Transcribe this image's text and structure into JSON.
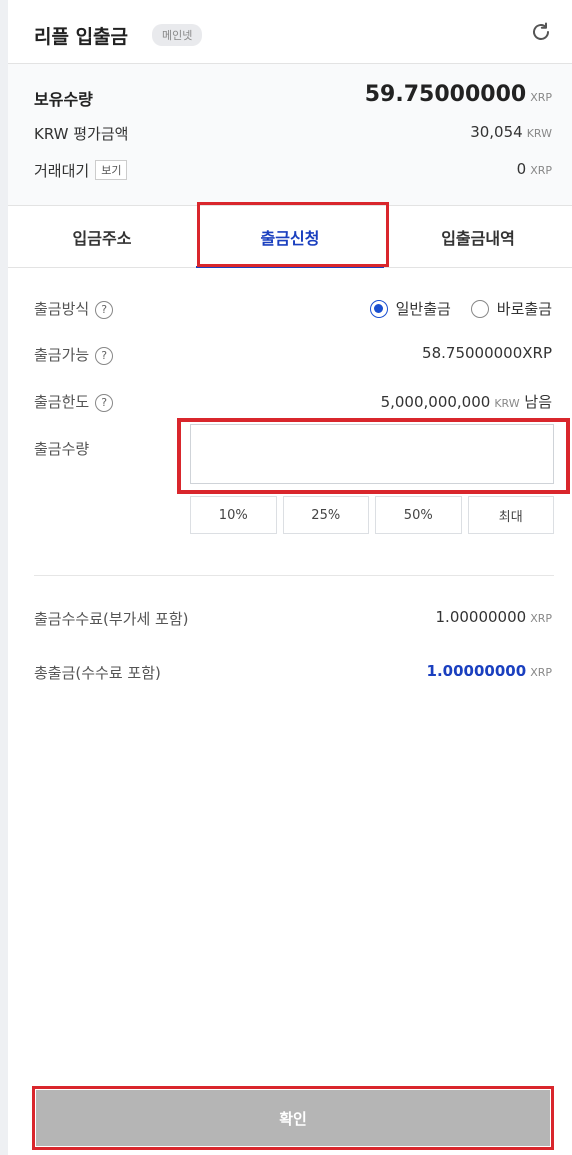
{
  "header": {
    "title": "리플 입출금",
    "network_badge": "메인넷",
    "refresh_icon": "refresh-icon"
  },
  "holdings": {
    "balance_label": "보유수량",
    "balance_value": "59.75000000",
    "balance_unit": "XRP",
    "krw_label": "KRW 평가금액",
    "krw_value": "30,054",
    "krw_unit": "KRW",
    "pending_label": "거래대기",
    "view_button": "보기",
    "pending_value": "0",
    "pending_unit": "XRP"
  },
  "tabs": [
    {
      "label": "입금주소",
      "active": false
    },
    {
      "label": "출금신청",
      "active": true
    },
    {
      "label": "입출금내역",
      "active": false
    }
  ],
  "form": {
    "method_label": "출금방식",
    "method_options": [
      {
        "label": "일반출금",
        "checked": true
      },
      {
        "label": "바로출금",
        "checked": false
      }
    ],
    "available_label": "출금가능",
    "available_value": "58.75000000XRP",
    "limit_label": "출금한도",
    "limit_value": "5,000,000,000",
    "limit_unit": "KRW",
    "limit_suffix": "남음",
    "amount_label": "출금수량",
    "amount_value": "",
    "amount_placeholder": "",
    "percent_buttons": [
      "10%",
      "25%",
      "50%",
      "최대"
    ],
    "help_glyph": "?"
  },
  "fees": {
    "fee_label": "출금수수료(부가세 포함)",
    "fee_value": "1.00000000",
    "fee_unit": "XRP",
    "total_label": "총출금(수수료 포함)",
    "total_value": "1.00000000",
    "total_unit": "XRP"
  },
  "confirm_button": "확인",
  "colors": {
    "accent": "#1a3fbf",
    "highlight": "#d9262c",
    "disabled_button": "#b5b5b5"
  }
}
